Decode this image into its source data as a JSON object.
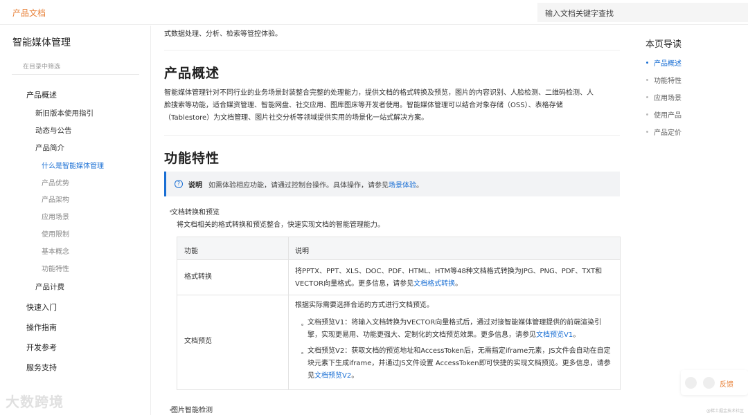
{
  "header": {
    "brand": "产品文档",
    "search_placeholder": "输入文档关键字查找"
  },
  "sidebar": {
    "title": "智能媒体管理",
    "filter_placeholder": "在目录中筛选",
    "items": [
      {
        "label": "产品概述",
        "level": 1
      },
      {
        "label": "新旧版本使用指引",
        "level": 2
      },
      {
        "label": "动态与公告",
        "level": 2
      },
      {
        "label": "产品简介",
        "level": 2
      },
      {
        "label": "什么是智能媒体管理",
        "level": 3,
        "active": true
      },
      {
        "label": "产品优势",
        "level": 3
      },
      {
        "label": "产品架构",
        "level": 3
      },
      {
        "label": "应用场景",
        "level": 3
      },
      {
        "label": "使用限制",
        "level": 3
      },
      {
        "label": "基本概念",
        "level": 3
      },
      {
        "label": "功能特性",
        "level": 3
      },
      {
        "label": "产品计费",
        "level": 2
      },
      {
        "label": "快速入门",
        "level": 1
      },
      {
        "label": "操作指南",
        "level": 1
      },
      {
        "label": "开发参考",
        "level": 1
      },
      {
        "label": "服务支持",
        "level": 1
      }
    ]
  },
  "watermark": "大数跨境",
  "main": {
    "intro_tail": "式数据处理、分析、检索等管控体验。",
    "overview_heading": "产品概述",
    "overview_lines": [
      "智能媒体管理针对不同行业的业务场景封装整合完整的处理能力，提供文档的格式转换及预览，图片的内容识别、人脸检测、二维码检测、人",
      "脸搜索等功能，适合媒资管理、智能网盘、社交应用、图库图床等开发者使用。智能媒体管理可以结合对象存储（OSS）、表格存储",
      "（Tablestore）为文档管理、图片社交分析等领域提供实用的场景化一站式解决方案。"
    ],
    "features_heading": "功能特性",
    "note": {
      "label": "说明",
      "text": "如需体验相应功能，请通过控制台操作。具体操作，请参见",
      "link": "场景体验",
      "end": "。"
    },
    "bullet1_title": "文档转换和预览",
    "bullet1_desc": "将文档相关的格式转换和预览整合，快速实现文档的智能管理能力。",
    "table": {
      "headers": [
        "功能",
        "说明"
      ],
      "row1": {
        "name": "格式转换",
        "line1": "将PPTX、PPT、XLS、DOC、PDF、HTML、HTM等48种文档格式转换为JPG、PNG、PDF、TXT和",
        "line2_pre": "VECTOR向量格式。更多信息，请参见",
        "line2_link": "文档格式转换",
        "line2_end": "。"
      },
      "row2": {
        "name": "文档预览",
        "intro": "根据实际需要选择合适的方式进行文档预览。",
        "v1_line1": "文档预览V1：将输入文档转换为VECTOR向量格式后，通过对接智能媒体管理提供的前端渲染引",
        "v1_line2_pre": "擎，实现更易用、功能更强大、定制化的文档预览效果。更多信息，请参见",
        "v1_link": "文档预览V1",
        "v1_end": "。",
        "v2_line1": "文档预览V2：获取文档的预览地址和AccessToken后，无需指定iframe元素，JS文件会自动在自定",
        "v2_line2": "块元素下生成iframe，并通过JS文件设置 AccessToken即可快捷的实现文档预览。更多信息，请参",
        "v2_line3_pre": "见",
        "v2_link": "文档预览V2",
        "v2_end": "。"
      }
    },
    "bullet2_title": "图片智能检测"
  },
  "toc": {
    "title": "本页导读",
    "items": [
      "产品概述",
      "功能特性",
      "应用场景",
      "使用产品",
      "产品定价"
    ]
  },
  "feedback": {
    "label": "反馈"
  },
  "credit": "@稀土掘金技术社区"
}
